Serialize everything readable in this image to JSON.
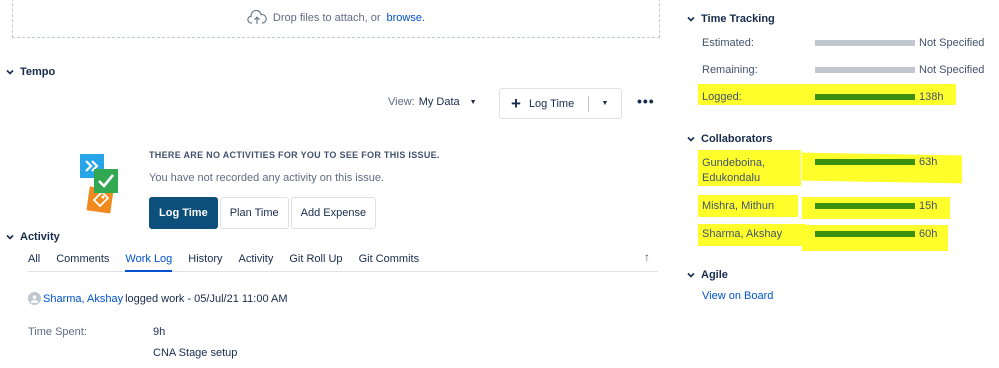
{
  "dropzone": {
    "text": "Drop files to attach, or",
    "link": "browse."
  },
  "tempo": {
    "title": "Tempo",
    "view_label": "View:",
    "view_value": "My Data",
    "log_time_label": "Log Time",
    "empty_title": "THERE ARE NO ACTIVITIES FOR YOU TO SEE FOR THIS ISSUE.",
    "empty_sub": "You have not recorded any activity on this issue.",
    "buttons": {
      "log_time": "Log Time",
      "plan_time": "Plan Time",
      "add_expense": "Add Expense"
    }
  },
  "activity": {
    "title": "Activity",
    "tabs": [
      {
        "label": "All"
      },
      {
        "label": "Comments"
      },
      {
        "label": "Work Log"
      },
      {
        "label": "History"
      },
      {
        "label": "Activity"
      },
      {
        "label": "Git Roll Up"
      },
      {
        "label": "Git Commits"
      }
    ],
    "active_tab": "Work Log",
    "worklog": {
      "author": "Sharma, Akshay",
      "action": "logged work - 05/Jul/21 11:00 AM",
      "time_spent_label": "Time Spent:",
      "time_spent_value": "9h",
      "description": "CNA Stage setup"
    }
  },
  "time_tracking": {
    "title": "Time Tracking",
    "rows": [
      {
        "label": "Estimated:",
        "value": "Not Specified",
        "fill": 0
      },
      {
        "label": "Remaining:",
        "value": "Not Specified",
        "fill": 0
      },
      {
        "label": "Logged:",
        "value": "138h",
        "fill": 1
      }
    ]
  },
  "collaborators": {
    "title": "Collaborators",
    "rows": [
      {
        "name_line1": "Gundeboina,",
        "name_line2": "Edukondalu",
        "value": "63h",
        "fill": 1
      },
      {
        "name_line1": "Mishra, Mithun",
        "value": "15h",
        "fill": 1
      },
      {
        "name_line1": "Sharma, Akshay",
        "value": "60h",
        "fill": 1
      }
    ]
  },
  "agile": {
    "title": "Agile",
    "link": "View on Board"
  },
  "colors": {
    "highlight": "#ffff2b",
    "bar_fill": "#3b8f0e",
    "bar_empty": "#c1c7d0",
    "link": "#0052cc",
    "primary_button": "#0b4f7a"
  }
}
